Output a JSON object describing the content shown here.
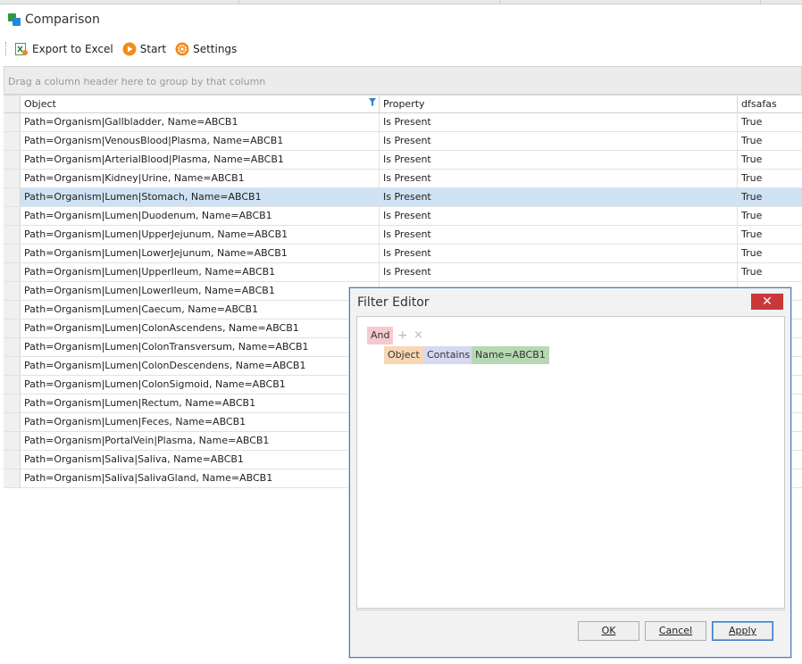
{
  "window": {
    "title": "Comparison"
  },
  "toolbar": {
    "export_label": "Export to Excel",
    "start_label": "Start",
    "settings_label": "Settings"
  },
  "group_panel": {
    "hint": "Drag a column header here to group by that column"
  },
  "grid": {
    "columns": [
      "Object",
      "Property",
      "dfsafas"
    ],
    "selected_row": 4,
    "rows": [
      [
        "Path=Organism|Gallbladder, Name=ABCB1",
        "Is Present",
        "True"
      ],
      [
        "Path=Organism|VenousBlood|Plasma, Name=ABCB1",
        "Is Present",
        "True"
      ],
      [
        "Path=Organism|ArterialBlood|Plasma, Name=ABCB1",
        "Is Present",
        "True"
      ],
      [
        "Path=Organism|Kidney|Urine, Name=ABCB1",
        "Is Present",
        "True"
      ],
      [
        "Path=Organism|Lumen|Stomach, Name=ABCB1",
        "Is Present",
        "True"
      ],
      [
        "Path=Organism|Lumen|Duodenum, Name=ABCB1",
        "Is Present",
        "True"
      ],
      [
        "Path=Organism|Lumen|UpperJejunum, Name=ABCB1",
        "Is Present",
        "True"
      ],
      [
        "Path=Organism|Lumen|LowerJejunum, Name=ABCB1",
        "Is Present",
        "True"
      ],
      [
        "Path=Organism|Lumen|UpperIleum, Name=ABCB1",
        "Is Present",
        "True"
      ],
      [
        "Path=Organism|Lumen|LowerIleum, Name=ABCB1",
        "",
        ""
      ],
      [
        "Path=Organism|Lumen|Caecum, Name=ABCB1",
        "",
        ""
      ],
      [
        "Path=Organism|Lumen|ColonAscendens, Name=ABCB1",
        "",
        ""
      ],
      [
        "Path=Organism|Lumen|ColonTransversum, Name=ABCB1",
        "",
        ""
      ],
      [
        "Path=Organism|Lumen|ColonDescendens, Name=ABCB1",
        "",
        ""
      ],
      [
        "Path=Organism|Lumen|ColonSigmoid, Name=ABCB1",
        "",
        ""
      ],
      [
        "Path=Organism|Lumen|Rectum, Name=ABCB1",
        "",
        ""
      ],
      [
        "Path=Organism|Lumen|Feces, Name=ABCB1",
        "",
        ""
      ],
      [
        "Path=Organism|PortalVein|Plasma, Name=ABCB1",
        "",
        ""
      ],
      [
        "Path=Organism|Saliva|Saliva, Name=ABCB1",
        "",
        ""
      ],
      [
        "Path=Organism|Saliva|SalivaGland, Name=ABCB1",
        "",
        ""
      ]
    ]
  },
  "filter_editor": {
    "title": "Filter Editor",
    "close_glyph": "✕",
    "group_operator": "And",
    "add_glyph": "+",
    "remove_glyph": "×",
    "condition": {
      "field": "Object",
      "operator": "Contains",
      "value": "Name=ABCB1"
    },
    "ok_label": "OK",
    "cancel_label": "Cancel",
    "apply_label": "Apply"
  },
  "colors": {
    "selection": "#cfe2f3",
    "close_button": "#c9373b",
    "chip_and": "#f6c9cf",
    "chip_field": "#f7d8b4",
    "chip_operator": "#d6d9f1",
    "chip_value": "#b6d8b2"
  }
}
